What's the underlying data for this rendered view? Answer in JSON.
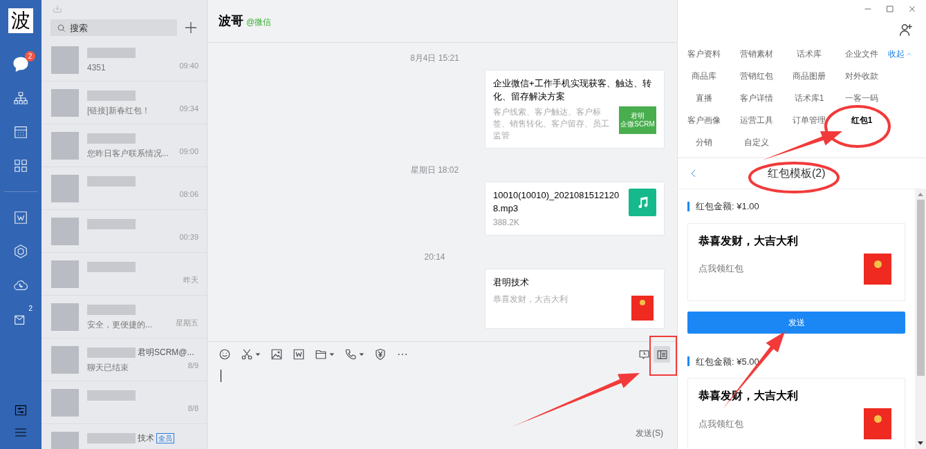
{
  "sidebar": {
    "logo": "波",
    "nav": [
      {
        "kind": "chat",
        "selected": true,
        "badge": "2"
      },
      {
        "kind": "org",
        "selected": false
      },
      {
        "kind": "calendar",
        "selected": false
      },
      {
        "kind": "apps",
        "selected": false
      },
      {
        "kind": "doc",
        "selected": false
      },
      {
        "kind": "cube",
        "selected": false
      },
      {
        "kind": "cloud-phone",
        "selected": false
      },
      {
        "kind": "mail",
        "selected": false,
        "superscript": "2"
      }
    ],
    "bottom": [
      {
        "kind": "settings"
      },
      {
        "kind": "menu"
      }
    ]
  },
  "chat_list": {
    "search": {
      "placeholder": "搜索"
    },
    "items": [
      {
        "preview": "4351",
        "time": "09:40"
      },
      {
        "preview": "[链接]新春红包！",
        "time": "09:34"
      },
      {
        "preview": "您昨日客户联系情况...",
        "time": "09:00"
      },
      {
        "time": "08:06"
      },
      {
        "time": "00:39"
      },
      {
        "time": "昨天"
      },
      {
        "preview": "安全，更便捷的...",
        "time": "星期五"
      },
      {
        "name_suffix": "君明SCRM@...",
        "preview": "聊天已结束",
        "time": "8/9"
      },
      {
        "time": "8/8"
      },
      {
        "name_suffix": "技术",
        "tag": "全员"
      }
    ]
  },
  "chat": {
    "title": "波哥",
    "source": "@微信",
    "messages": [
      {
        "time": "8月4日 15:21",
        "kind": "link",
        "title": "企业微信+工作手机实现获客、触达、转化、留存解决方案",
        "desc": "客户线索、客户触达、客户标签、销售转化、客户留存、员工监管",
        "thumb": [
          "君明",
          "企微SCRM"
        ]
      },
      {
        "time": "星期日 18:02",
        "kind": "file",
        "title": "10010(10010)_20210815121208.mp3",
        "size": "388.2K"
      },
      {
        "time": "20:14",
        "kind": "redpacket",
        "title": "君明技术",
        "desc": "恭喜发财，大吉大利"
      }
    ],
    "toolbar": [
      {
        "kind": "emoji"
      },
      {
        "kind": "scissors",
        "menu": true
      },
      {
        "kind": "image"
      },
      {
        "kind": "word"
      },
      {
        "kind": "folder",
        "menu": true
      },
      {
        "kind": "phone",
        "menu": true
      },
      {
        "kind": "yen-shield"
      },
      {
        "kind": "more"
      }
    ],
    "toolbar_right": [
      {
        "kind": "history",
        "selected": false
      },
      {
        "kind": "side-panel",
        "selected": true
      }
    ],
    "send": "发送(S)"
  },
  "panel": {
    "collapse": "收起",
    "tools": [
      {
        "label": "客户资料",
        "selected": false
      },
      {
        "label": "营销素材",
        "selected": false
      },
      {
        "label": "话术库",
        "selected": false
      },
      {
        "label": "企业文件",
        "selected": false
      },
      {
        "label": "商品库",
        "selected": false
      },
      {
        "label": "营销红包",
        "selected": false
      },
      {
        "label": "商品图册",
        "selected": false
      },
      {
        "label": "对外收款",
        "selected": false
      },
      {
        "label": "直播",
        "selected": false
      },
      {
        "label": "客户详情",
        "selected": false
      },
      {
        "label": "话术库1",
        "selected": false
      },
      {
        "label": "一客一码",
        "selected": false
      },
      {
        "label": "客户画像",
        "selected": false
      },
      {
        "label": "运营工具",
        "selected": false
      },
      {
        "label": "订单管理",
        "selected": false
      },
      {
        "label": "红包1",
        "selected": true
      },
      {
        "label": "分销",
        "selected": false
      },
      {
        "label": "自定义",
        "selected": false
      }
    ],
    "title": "红包模板(2)",
    "templates": [
      {
        "amount": "红包金额: ¥1.00",
        "title": "恭喜发财，大吉大利",
        "desc": "点我领红包",
        "send": "发送"
      },
      {
        "amount": "红包金额: ¥5.00",
        "title": "恭喜发财，大吉大利",
        "desc": "点我领红包"
      }
    ]
  }
}
